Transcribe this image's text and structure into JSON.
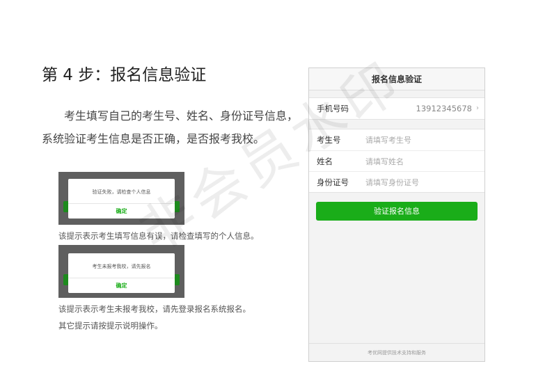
{
  "page": {
    "step_title": "第 4 步：报名信息验证",
    "description": "考生填写自己的考生号、姓名、身份证号信息，系统验证考生信息是否正确，是否报考我校。"
  },
  "examples": [
    {
      "dialog_message": "验证失败，请检查个人信息",
      "dialog_button": "确定",
      "caption": "该提示表示考生填写信息有误，请检查填写的个人信息。"
    },
    {
      "dialog_message": "考生未报考我校，请先报名",
      "dialog_button": "确定",
      "caption": "该提示表示考生未报考我校，请先登录报名系统报名。"
    }
  ],
  "other_note": "其它提示请按提示说明操作。",
  "phone": {
    "header_title": "报名信息验证",
    "phone_label": "手机号码",
    "phone_value": "13912345678",
    "fields": [
      {
        "label": "考生号",
        "placeholder": "请填写考生号"
      },
      {
        "label": "姓名",
        "placeholder": "请填写姓名"
      },
      {
        "label": "身份证号",
        "placeholder": "请填写身份证号"
      }
    ],
    "submit_label": "验证报名信息",
    "footer": "考优网提供技术支持和服务"
  },
  "watermark": "非会员水印",
  "icons": {
    "chevron": "chevron-right-icon"
  },
  "colors": {
    "accent": "#1aad19"
  }
}
